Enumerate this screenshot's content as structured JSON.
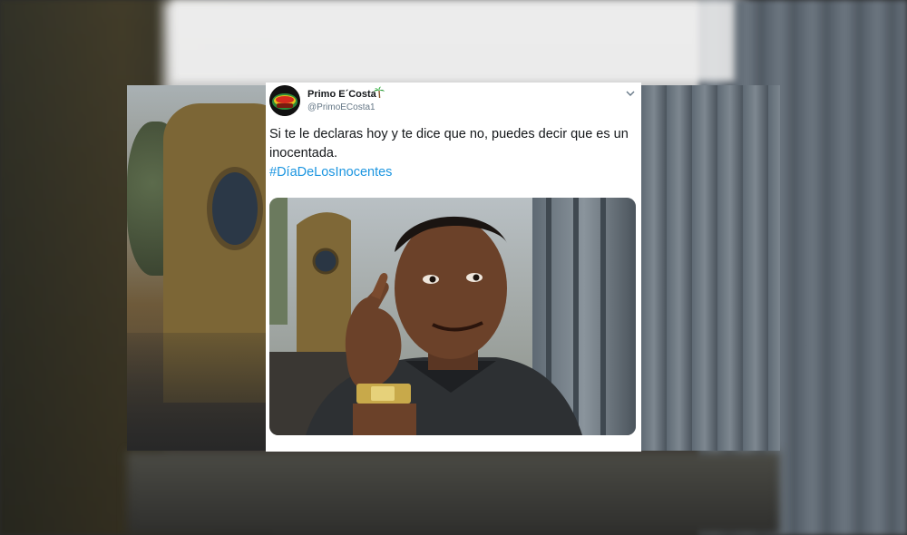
{
  "tweet": {
    "display_name": "Primo E´Costa",
    "handle": "@PrimoECosta1",
    "text": "Si te le declaras hoy y te dice que no, puedes decir que es un inocentada.",
    "hashtag": "#DíaDeLosInocentes",
    "icons": {
      "name_emoji": "palm-tree-icon",
      "menu": "chevron-down-icon"
    }
  },
  "colors": {
    "hashtag": "#1b95e0",
    "name": "#14171a",
    "handle": "#657786",
    "card_bg": "#ffffff"
  }
}
